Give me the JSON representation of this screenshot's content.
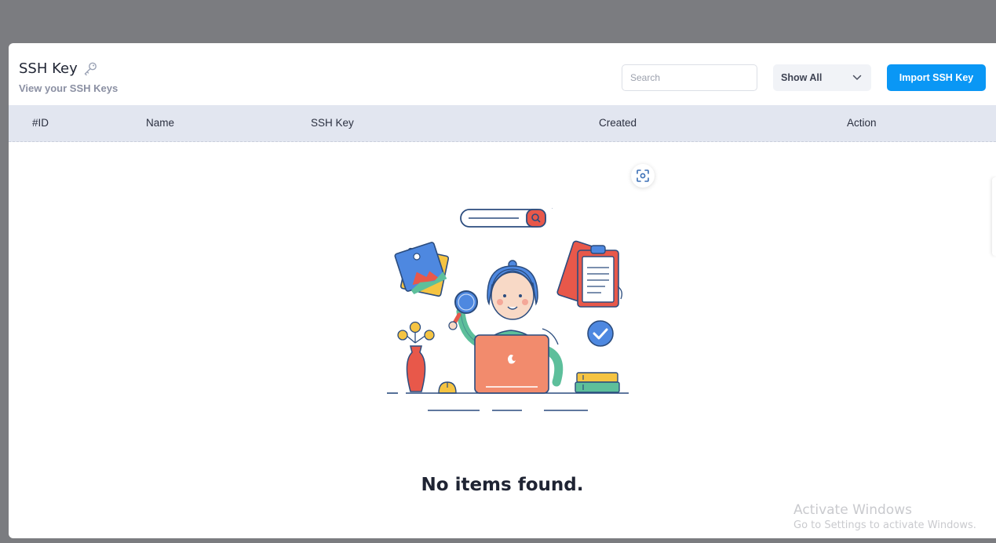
{
  "header": {
    "title": "SSH Key",
    "subtitle": "View your SSH Keys"
  },
  "toolbar": {
    "search_placeholder": "Search",
    "filter_value": "Show All",
    "import_label": "Import SSH Key"
  },
  "table": {
    "columns": [
      "#ID",
      "Name",
      "SSH Key",
      "Created",
      "Action"
    ]
  },
  "empty_state": {
    "message": "No items found."
  },
  "watermark": {
    "line1": "Activate Windows",
    "line2": "Go to Settings to activate Windows."
  },
  "colors": {
    "accent": "#0a97f5",
    "header_bg": "#e2e6f0",
    "backdrop": "#7b7c80"
  }
}
